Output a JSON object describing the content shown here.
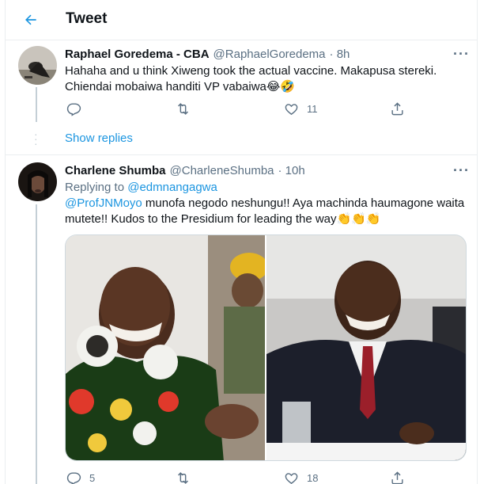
{
  "header": {
    "title": "Tweet"
  },
  "reply1": {
    "name": "Raphael Goredema - CBA",
    "handle": "@RaphaelGoredema",
    "time": "· 8h",
    "text_line1": "Hahaha and u think Xiweng took the actual vaccine. Makapusa stereki.",
    "text_line2": "Chiendai mobaiwa handiti VP vabaiwa😂🤣",
    "likes": "11",
    "show_replies": "Show replies"
  },
  "reply2": {
    "name": "Charlene Shumba",
    "handle": "@CharleneShumba",
    "time": "· 10h",
    "replying_prefix": "Replying to ",
    "replying_to": "@edmnangagwa",
    "mention": "@ProfJNMoyo",
    "text_rest1": " munofa negodo neshungu!! Aya machinda haumagone waita",
    "text_line2": "mutete!! Kudos to the Presidium for leading the way👏👏👏",
    "replies": "5",
    "likes": "18"
  },
  "icons": [
    "back-arrow-icon",
    "more-icon",
    "reply-icon",
    "retweet-icon",
    "like-icon",
    "share-icon"
  ],
  "colors": {
    "accent": "#1b95e0",
    "muted": "#5b7083",
    "border": "#ebeef0"
  }
}
